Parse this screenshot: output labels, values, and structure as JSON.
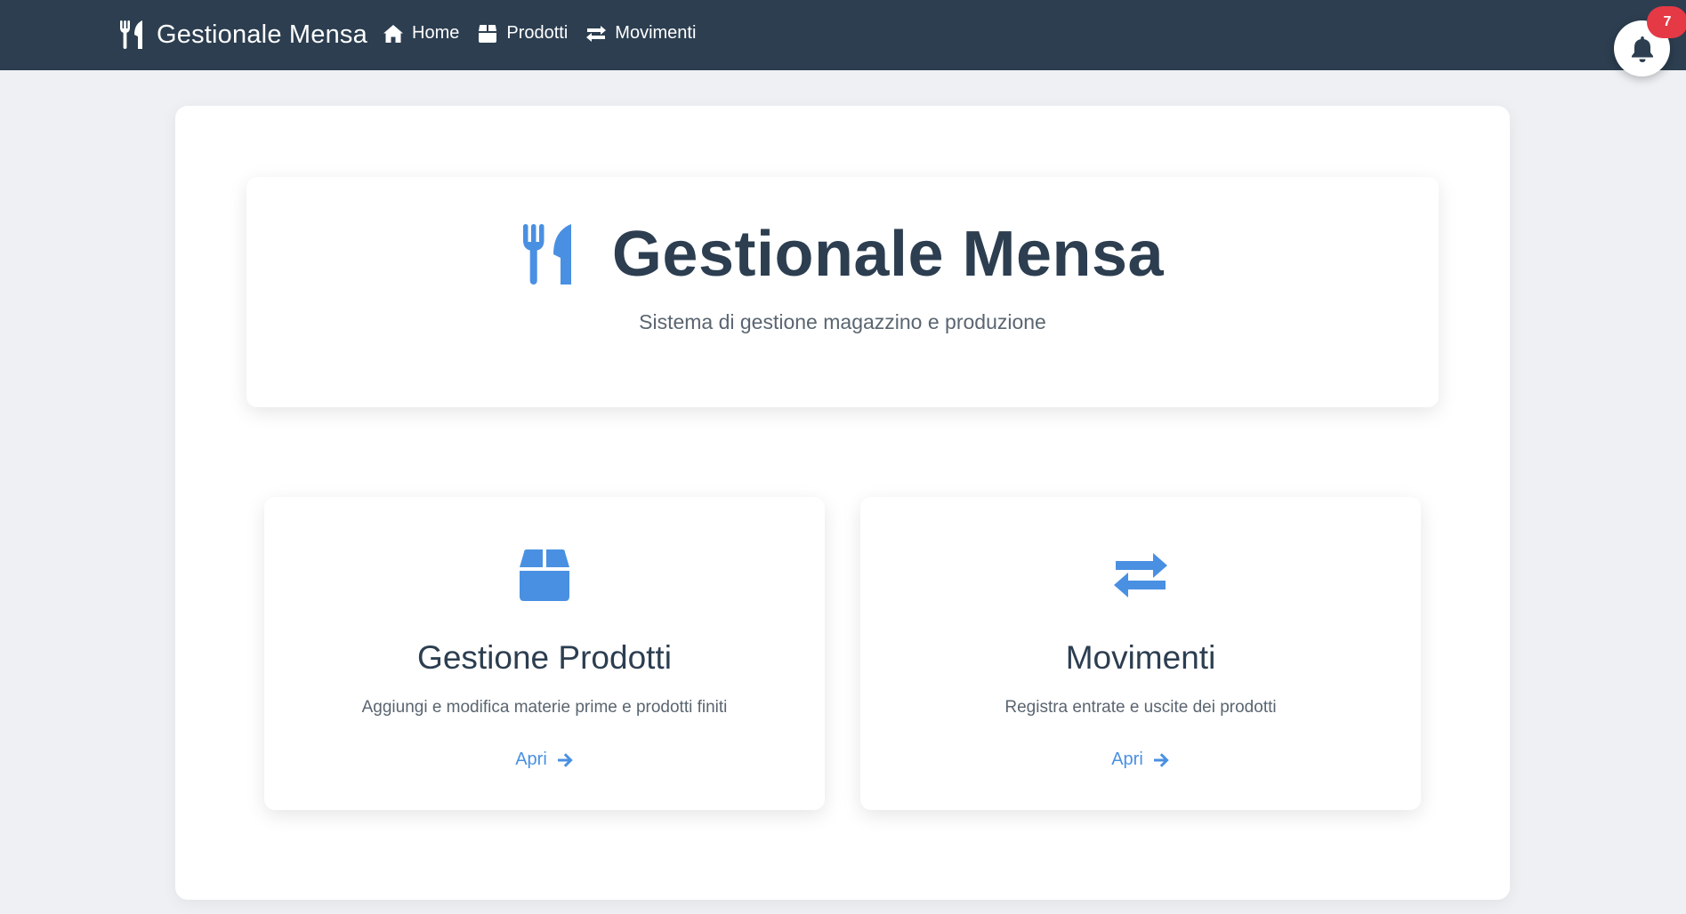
{
  "navbar": {
    "brand": {
      "label": "Gestionale Mensa",
      "icon": "utensils-icon"
    },
    "links": [
      {
        "label": "Home",
        "icon": "home-icon"
      },
      {
        "label": "Prodotti",
        "icon": "box-icon"
      },
      {
        "label": "Movimenti",
        "icon": "exchange-icon"
      }
    ],
    "notifications": {
      "icon": "bell-icon",
      "count": "7"
    }
  },
  "hero": {
    "icon": "utensils-icon",
    "title": "Gestionale Mensa",
    "subtitle": "Sistema di gestione magazzino e produzione"
  },
  "cards": [
    {
      "icon": "box-icon",
      "title": "Gestione Prodotti",
      "description": "Aggiungi e modifica materie prime e prodotti finiti",
      "link_label": "Apri"
    },
    {
      "icon": "exchange-icon",
      "title": "Movimenti",
      "description": "Registra entrate e uscite dei prodotti",
      "link_label": "Apri"
    }
  ],
  "colors": {
    "navbar": "#2c3e50",
    "accent": "#4a90e2",
    "badge": "#e53945",
    "background": "#eef0f3"
  }
}
